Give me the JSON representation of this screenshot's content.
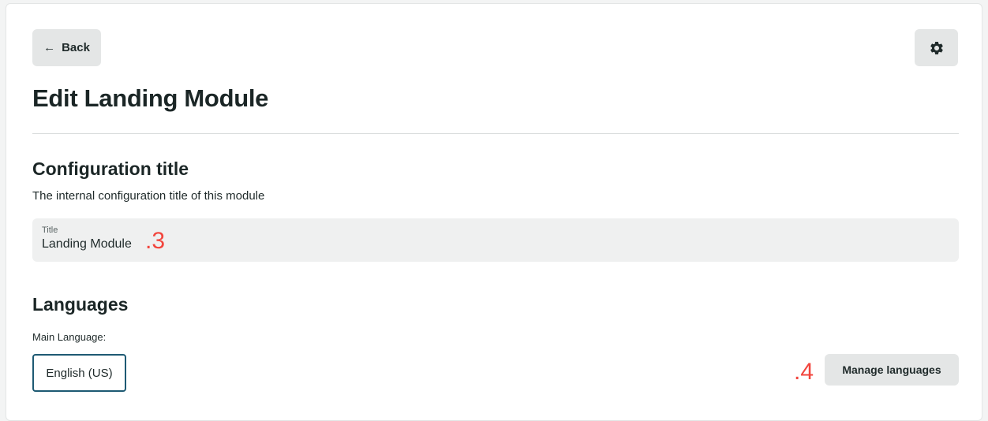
{
  "header": {
    "back_label": "Back",
    "back_icon": "arrow-left-icon",
    "settings_icon": "gear-icon",
    "page_title": "Edit Landing Module"
  },
  "configuration": {
    "title": "Configuration title",
    "description": "The internal configuration title of this module",
    "field_label": "Title",
    "field_value": "Landing Module"
  },
  "languages": {
    "title": "Languages",
    "main_language_label": "Main Language:",
    "main_language_value": "English (US)",
    "manage_label": "Manage languages"
  },
  "annotations": {
    "a3": ".3",
    "a4": ".4"
  },
  "colors": {
    "accent_border": "#1e5a73",
    "annotation": "#f2453d",
    "button_bg": "#e4e6e6"
  }
}
